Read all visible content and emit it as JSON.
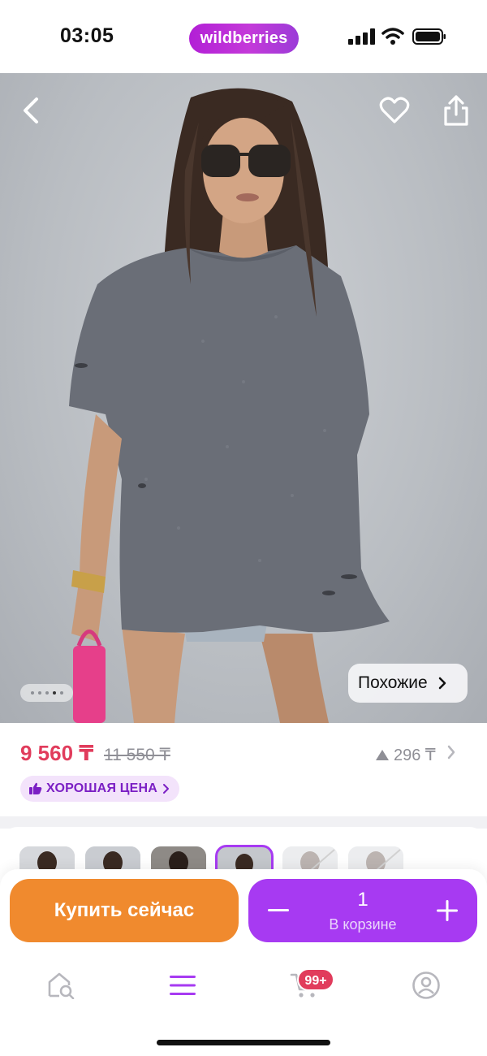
{
  "status_bar": {
    "time": "03:05",
    "brand": "wildberries"
  },
  "hero": {
    "image_count": 5,
    "active_image_index": 3,
    "similar_label": "Похожие",
    "icons": [
      "chevron-left-icon",
      "heart-icon",
      "share-icon",
      "chevron-right-icon"
    ]
  },
  "price": {
    "current": "9 560 ₸",
    "old": "11 550 ₸",
    "delta": "296 ₸",
    "good_price_label": "ХОРОШАЯ ЦЕНА"
  },
  "variants": {
    "count_visible": 6,
    "selected_index": 3,
    "unavailable": [
      4,
      5
    ]
  },
  "actions": {
    "buy_label": "Купить сейчас",
    "quantity": "1",
    "in_cart_label": "В корзине"
  },
  "tabbar": {
    "items": [
      "home-search-icon",
      "menu-icon",
      "cart-icon",
      "profile-icon"
    ],
    "active": "menu-icon",
    "cart_badge": "99+"
  },
  "colors": {
    "accent_purple": "#a73af2",
    "buy_orange": "#f08a2e",
    "price_red": "#e13c5c",
    "brand_pink": "#c43ad9"
  }
}
